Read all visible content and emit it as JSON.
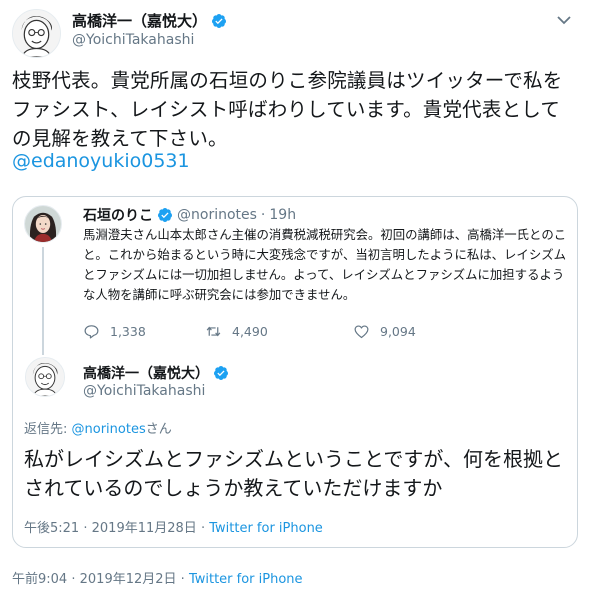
{
  "main_tweet": {
    "author_name": "高橋洋一（嘉悦大）",
    "author_handle": "@YoichiTakahashi",
    "text": "枝野代表。貴党所属の石垣のりこ参院議員はツイッターで私をファシスト、レイシスト呼ばわりしています。貴党代表としての見解を教えて下さい。",
    "mention": "@edanoyukio0531",
    "time": "午前9:04",
    "date": "2019年12月2日",
    "source": "Twitter for iPhone",
    "separator": "·"
  },
  "quoted_tweet": {
    "author_name": "石垣のりこ",
    "author_handle": "@norinotes",
    "age": "19h",
    "separator": "·",
    "text": "馬淵澄夫さん山本太郎さん主催の消費税減税研究会。初回の講師は、高橋洋一氏とのこと。これから始まるという時に大変残念ですが、当初言明したように私は、レイシズムとファシズムには一切加担しません。よって、レイシズムとファシズムに加担するような人物を講師に呼ぶ研究会には参加できません。",
    "replies": "1,338",
    "retweets": "4,490",
    "likes": "9,094"
  },
  "reply_tweet": {
    "author_name": "高橋洋一（嘉悦大）",
    "author_handle": "@YoichiTakahashi",
    "replying_label": "返信先: ",
    "replying_to": "@norinotes",
    "replying_suffix": "さん",
    "text": "私がレイシズムとファシズムということですが、何を根拠とされているのでしょうか教えていただけますか",
    "time": "午後5:21",
    "date": "2019年11月28日",
    "source": "Twitter for iPhone",
    "separator": "·"
  },
  "colors": {
    "link": "#1b95e0",
    "muted": "#657786",
    "border": "#ccd6dd",
    "verified": "#1da1f2"
  },
  "icons": {
    "verified": "verified-badge-icon",
    "chevron": "chevron-down-icon",
    "reply": "reply-icon",
    "retweet": "retweet-icon",
    "like": "heart-icon"
  }
}
